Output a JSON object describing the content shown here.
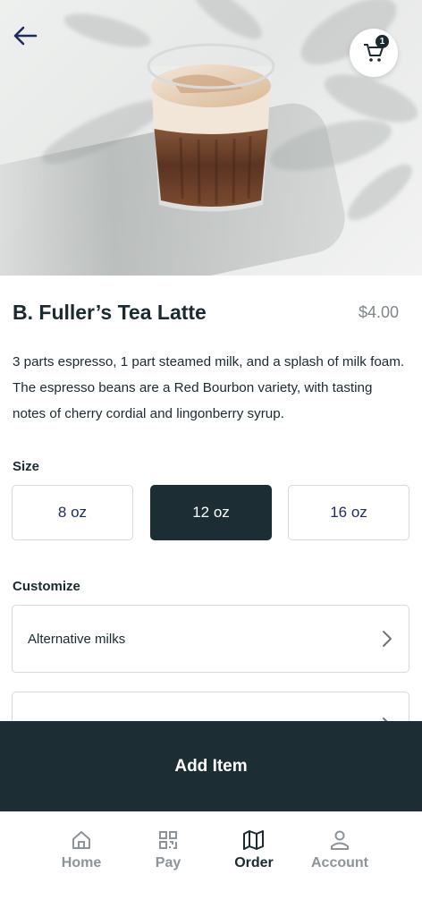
{
  "header": {
    "back_icon": "arrow-left-icon",
    "cart_icon": "cart-icon",
    "cart_count": "1"
  },
  "product": {
    "title": "B. Fuller’s Tea Latte",
    "price": "$4.00",
    "description": "3 parts espresso, 1 part steamed milk, and a splash of milk foam. The espresso beans are a Red Bourbon variety, with tasting notes of cherry cordial and lingonberry syrup."
  },
  "size": {
    "label": "Size",
    "options": [
      "8 oz",
      "12 oz",
      "16 oz"
    ],
    "selected": "12 oz"
  },
  "customize": {
    "label": "Customize",
    "items": [
      "Alternative milks",
      ""
    ]
  },
  "add_button": {
    "label": "Add Item"
  },
  "nav": {
    "items": [
      {
        "label": "Home",
        "icon": "home-icon"
      },
      {
        "label": "Pay",
        "icon": "qr-code-icon"
      },
      {
        "label": "Order",
        "icon": "map-icon"
      },
      {
        "label": "Account",
        "icon": "user-icon"
      }
    ],
    "active": "Order"
  },
  "colors": {
    "primary_dark": "#1c2e33",
    "accent_text": "#1f2b5c",
    "muted": "#8d9396"
  }
}
